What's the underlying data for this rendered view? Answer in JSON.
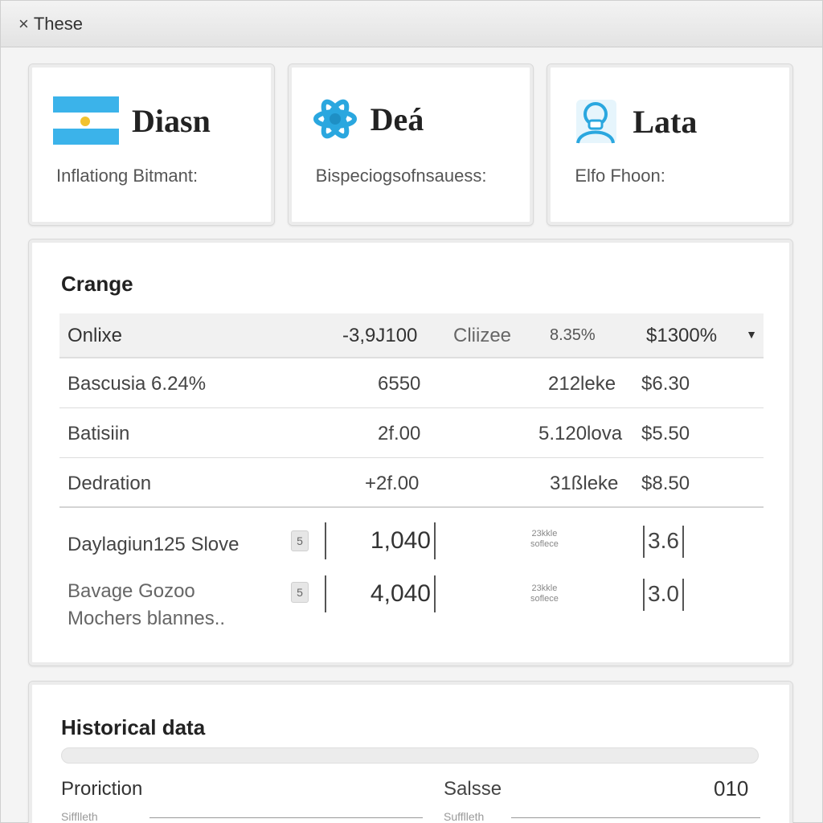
{
  "window": {
    "title": "These",
    "close_icon": "×"
  },
  "cards": [
    {
      "title": "Diasn",
      "subtitle": "Inflationg Bitmant:",
      "icon": "flag-icon"
    },
    {
      "title": "Deá",
      "subtitle": "Bispeciogsofnsauess:",
      "icon": "atom-icon"
    },
    {
      "title": "Lata",
      "subtitle": "Elfo Fhoon:",
      "icon": "user-icon"
    }
  ],
  "change": {
    "title": "Crange",
    "header": {
      "c1": "Onlixe",
      "c2": "-3,9J100",
      "c3": "Cliizee",
      "c4": "8.35%",
      "c5": "$1300%"
    },
    "rows": [
      {
        "c1": "Bascusia 6.24%",
        "c2": "6550",
        "c4": "212leke",
        "c5": "$6.30"
      },
      {
        "c1": "Batisiin",
        "c2": "2f.00",
        "c4": "5.120lova",
        "c5": "$5.50"
      },
      {
        "c1": "Dedration",
        "c2": "+2f.00",
        "c4": "31ßleke",
        "c5": "$8.50"
      }
    ],
    "entries": [
      {
        "label": "Daylagiun125 Slove",
        "label2": "",
        "btn": "5",
        "value": "1,040",
        "tiny1": "23kkle",
        "tiny2": "soflece",
        "bracket": "3.6"
      },
      {
        "label": "Bavage Gozoo",
        "label2": "Mochers blannes..",
        "btn": "5",
        "value": "4,040",
        "tiny1": "23kkle",
        "tiny2": "soflece",
        "bracket": "3.0"
      }
    ]
  },
  "history": {
    "title": "Historical data",
    "row": {
      "c1": "Proriction",
      "c2": "Salsse",
      "c3": "010"
    },
    "sub": {
      "c1": "Sifflleth",
      "c2": "Sufflleth"
    }
  },
  "colors": {
    "accent": "#3bb3ea",
    "flag_sun": "#f2c230"
  }
}
